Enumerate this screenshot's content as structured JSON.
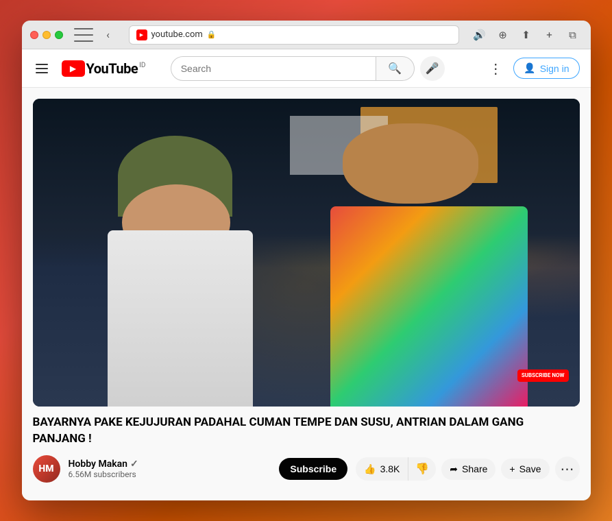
{
  "browser": {
    "address": "youtube.com",
    "speaker_icon": "🔊"
  },
  "header": {
    "logo_text": "YouTube",
    "logo_country": "ID",
    "search_placeholder": "Search",
    "sign_in_label": "Sign in",
    "more_options_label": "⋮"
  },
  "video": {
    "title": "BAYARNYA PAKE KEJUJURAN PADAHAL CUMAN TEMPE DAN SUSU, ANTRIAN DALAM GANG PANJANG !",
    "subscribe_overlay": "SUBSCRIBE NOW",
    "channel": {
      "name": "Hobby Makan",
      "verified": true,
      "subscribers": "6.56M subscribers",
      "avatar_letter": "HM"
    },
    "subscribe_btn": "Subscribe",
    "actions": {
      "like_count": "3.8K",
      "like_icon": "👍",
      "dislike_icon": "👎",
      "share_label": "Share",
      "share_icon": "➦",
      "save_label": "Save",
      "save_icon": "+"
    }
  }
}
